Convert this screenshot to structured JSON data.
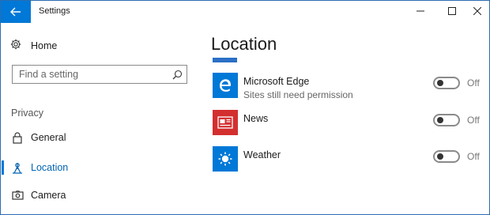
{
  "window": {
    "title": "Settings"
  },
  "sidebar": {
    "home_label": "Home",
    "search_placeholder": "Find a setting",
    "section_label": "Privacy",
    "items": [
      {
        "label": "General",
        "icon": "lock-icon",
        "active": false
      },
      {
        "label": "Location",
        "icon": "location-icon",
        "active": true
      },
      {
        "label": "Camera",
        "icon": "camera-icon",
        "active": false
      }
    ]
  },
  "main": {
    "title": "Location",
    "apps": [
      {
        "name": "Microsoft Edge",
        "subtitle": "Sites still need permission",
        "state": "Off",
        "icon": "edge-icon",
        "tile_color": "#0078d7"
      },
      {
        "name": "News",
        "subtitle": "",
        "state": "Off",
        "icon": "news-icon",
        "tile_color": "#d32f2f"
      },
      {
        "name": "Weather",
        "subtitle": "",
        "state": "Off",
        "icon": "weather-icon",
        "tile_color": "#0078d7"
      }
    ]
  },
  "colors": {
    "accent": "#0078d7",
    "news_tile": "#d32f2f"
  }
}
